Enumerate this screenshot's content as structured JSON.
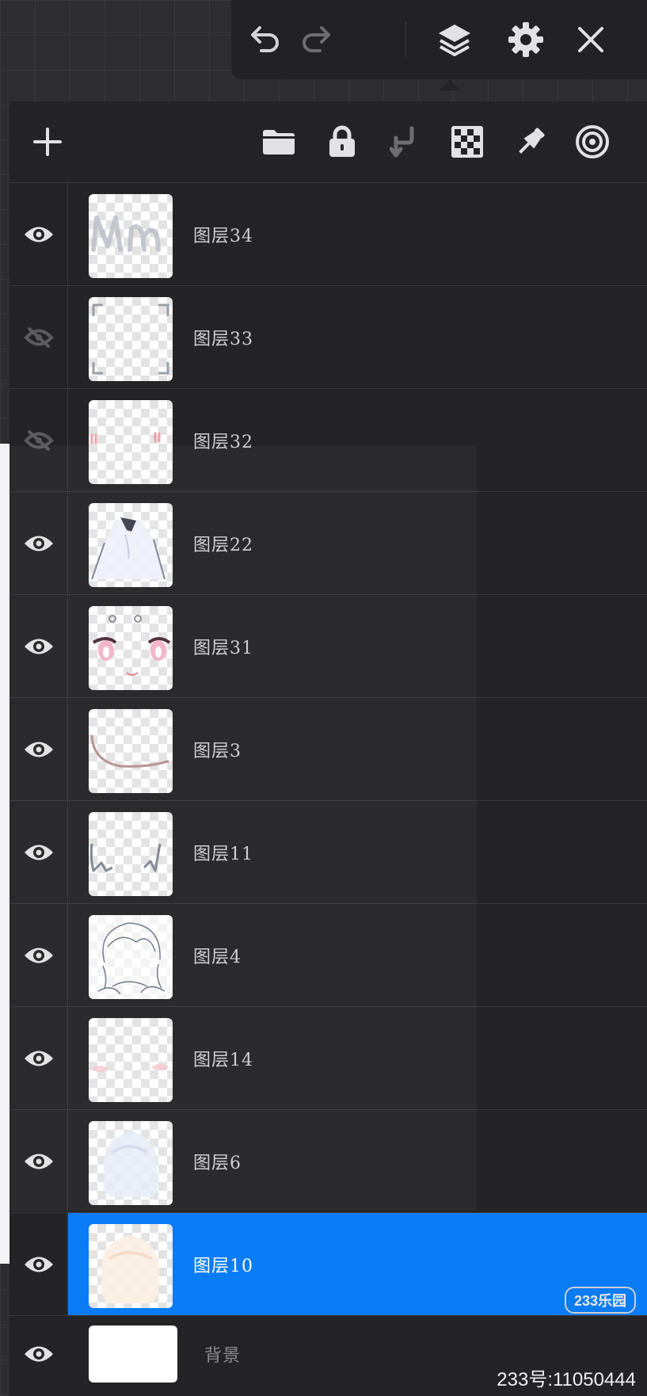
{
  "toolbar": {
    "icons": [
      "undo-icon",
      "redo-icon",
      "layers-icon",
      "settings-icon",
      "close-icon"
    ]
  },
  "panel_header": {
    "icons": [
      "add-layer-icon",
      "folder-icon",
      "lock-icon",
      "merge-down-icon",
      "transparency-icon",
      "pin-icon",
      "target-icon"
    ]
  },
  "layers": [
    {
      "name": "图层34",
      "visible": true,
      "selected": false
    },
    {
      "name": "图层33",
      "visible": false,
      "selected": false
    },
    {
      "name": "图层32",
      "visible": false,
      "selected": false
    },
    {
      "name": "图层22",
      "visible": true,
      "selected": false
    },
    {
      "name": "图层31",
      "visible": true,
      "selected": false
    },
    {
      "name": "图层3",
      "visible": true,
      "selected": false
    },
    {
      "name": "图层11",
      "visible": true,
      "selected": false
    },
    {
      "name": "图层4",
      "visible": true,
      "selected": false
    },
    {
      "name": "图层14",
      "visible": true,
      "selected": false
    },
    {
      "name": "图层6",
      "visible": true,
      "selected": false
    },
    {
      "name": "图层10",
      "visible": true,
      "selected": true
    }
  ],
  "background_layer": {
    "name": "背景",
    "visible": true
  },
  "watermark": {
    "logo": "233乐园",
    "id_text": "233号:11050444"
  },
  "colors": {
    "selected": "#0a7cf6",
    "panel": "#242426"
  }
}
